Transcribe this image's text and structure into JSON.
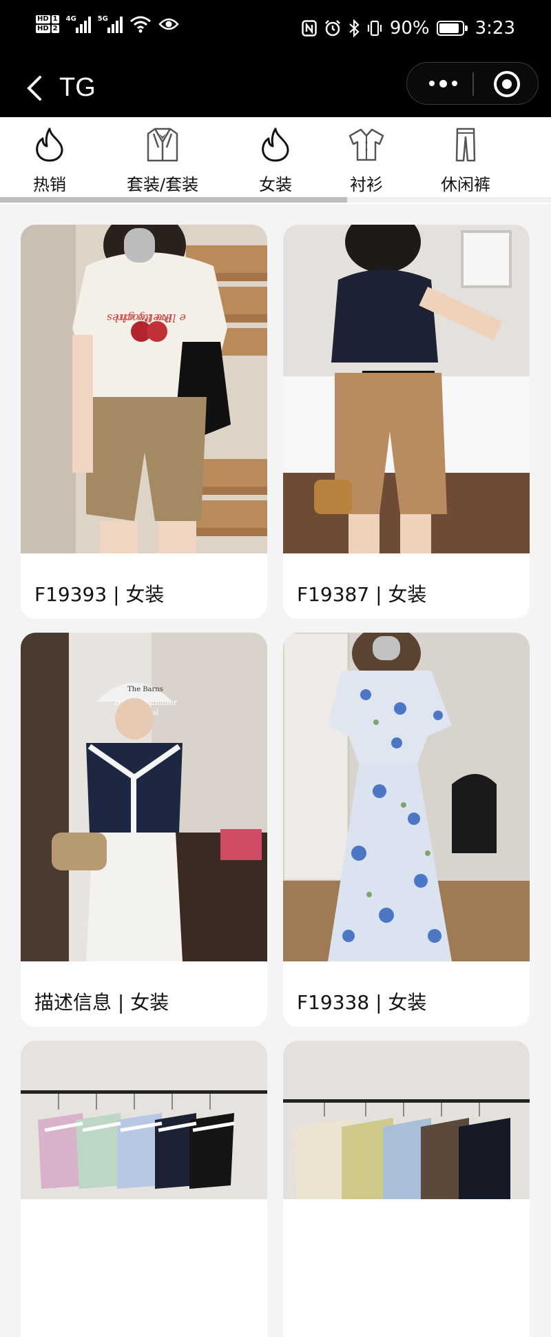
{
  "status_bar": {
    "hd1": "HD",
    "hd1_num": "1",
    "hd2": "HD",
    "hd2_num": "2",
    "net1": "4G",
    "net2": "5G",
    "battery_percent": "90%",
    "battery_level": 0.9,
    "time": "3:23",
    "icons": [
      "nfc-icon",
      "alarm-icon",
      "bluetooth-icon",
      "vibrate-icon",
      "wifi-icon",
      "eye-icon"
    ]
  },
  "nav": {
    "title": "TG"
  },
  "categories": [
    {
      "label": "热销",
      "icon": "flame-icon"
    },
    {
      "label": "套装/套装",
      "icon": "suit-icon"
    },
    {
      "label": "女装",
      "icon": "flame-icon"
    },
    {
      "label": "衬衫",
      "icon": "shirt-icon"
    },
    {
      "label": "休闲裤",
      "icon": "pants-icon"
    }
  ],
  "category_scroll_position": 0.63,
  "products": [
    {
      "label": "F19393 | 女装"
    },
    {
      "label": "F19387 | 女装"
    },
    {
      "label": "描述信息 | 女装"
    },
    {
      "label": "F19338 | 女装"
    },
    {
      "label": ""
    },
    {
      "label": ""
    }
  ],
  "photo_text": {
    "tee_print_1": "Pretty girl",
    "tee_print_2": "e like Peaches",
    "cap_text": "The Barns",
    "cap_caption_1": "2023 & Summer",
    "cap_caption_2": "new arrival"
  },
  "colors": {
    "background": "#f4f4f4",
    "header": "#000000",
    "card": "#ffffff",
    "scroll_thumb": "#bdbdbd"
  }
}
